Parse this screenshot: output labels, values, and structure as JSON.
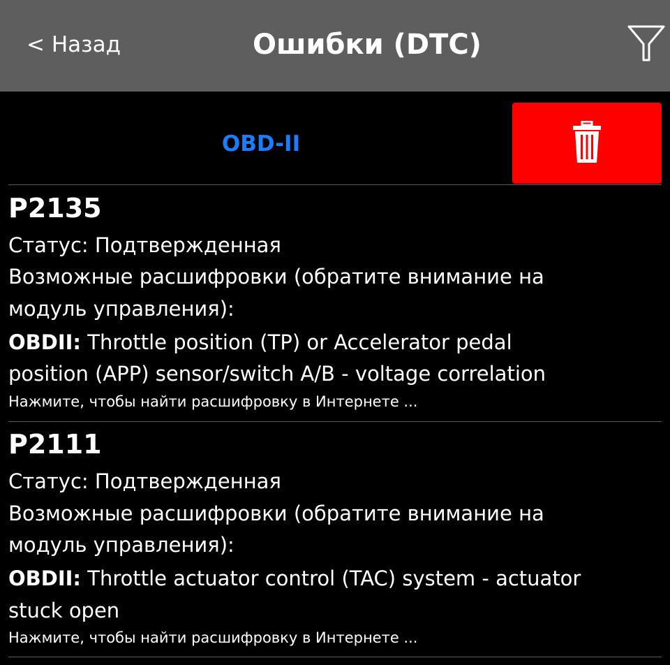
{
  "header": {
    "back_label": "< Назад",
    "title": "Ошибки (DTC)",
    "filter_icon": "filter-icon"
  },
  "toolbar": {
    "protocol_label": "OBD-II",
    "delete_icon": "trash-icon"
  },
  "colors": {
    "navbar_bg": "#5e5e5e",
    "background": "#000000",
    "accent_blue": "#1a7dfb",
    "delete_red": "#fe0000",
    "divider": "#5a5a5a"
  },
  "dtc_list": [
    {
      "code": "P2135",
      "status": "Статус: Подтвержденная",
      "decode_line1": "Возможные расшифровки (обратите внимание на",
      "decode_line2": "модуль управления):",
      "source": "OBDII:",
      "description_line1": " Throttle position (TP) or Accelerator pedal",
      "description_line2": "position (APP) sensor/switch A/B - voltage correlation",
      "search_hint": "Нажмите, чтобы найти расшифровку в Интернете ..."
    },
    {
      "code": "P2111",
      "status": "Статус: Подтвержденная",
      "decode_line1": "Возможные расшифровки (обратите внимание на",
      "decode_line2": "модуль управления):",
      "source": "OBDII:",
      "description_line1": " Throttle actuator control (TAC) system - actuator",
      "description_line2": "stuck open",
      "search_hint": "Нажмите, чтобы найти расшифровку в Интернете ..."
    }
  ]
}
